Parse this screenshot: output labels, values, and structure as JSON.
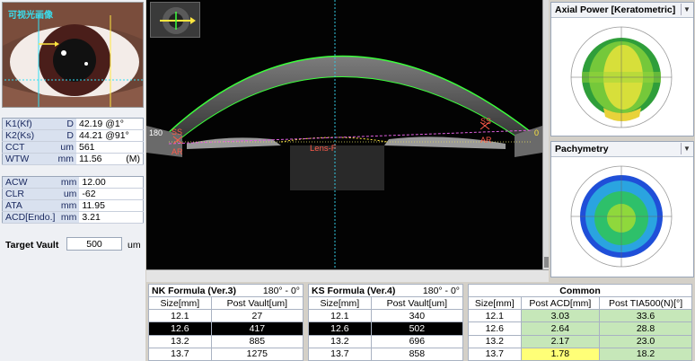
{
  "eye_photo": {
    "label": "可视光画像"
  },
  "measurements_a": [
    {
      "key": "K1(Kf)",
      "unit": "D",
      "value": "42.19 @1°"
    },
    {
      "key": "K2(Ks)",
      "unit": "D",
      "value": "44.21 @91°"
    },
    {
      "key": "CCT",
      "unit": "um",
      "value": "561"
    },
    {
      "key": "WTW",
      "unit": "mm",
      "value": "11.56",
      "flag": "(M)"
    }
  ],
  "measurements_b": [
    {
      "key": "ACW",
      "unit": "mm",
      "value": "12.00"
    },
    {
      "key": "CLR",
      "unit": "um",
      "value": "-62"
    },
    {
      "key": "ATA",
      "unit": "mm",
      "value": "11.95"
    },
    {
      "key": "ACD[Endo.]",
      "unit": "mm",
      "value": "3.21"
    }
  ],
  "target_vault": {
    "label": "Target Vault",
    "value": "500",
    "unit": "um"
  },
  "oct": {
    "left_tick": "180",
    "right_tick": "0",
    "ss_left": "SS",
    "ar_left": "AR",
    "ss_right": "SS",
    "ar_right": "AR",
    "lens_label": "Lens-F"
  },
  "maps": {
    "axial": {
      "title": "Axial Power [Keratometric]"
    },
    "pachy": {
      "title": "Pachymetry"
    }
  },
  "nk_formula": {
    "title": "NK Formula (Ver.3)",
    "angle": "180° - 0°",
    "headers": [
      "Size[mm]",
      "Post Vault[um]"
    ],
    "rows": [
      [
        "12.1",
        "27"
      ],
      [
        "12.6",
        "417"
      ],
      [
        "13.2",
        "885"
      ],
      [
        "13.7",
        "1275"
      ]
    ]
  },
  "ks_formula": {
    "title": "KS Formula (Ver.4)",
    "angle": "180° - 0°",
    "headers": [
      "Size[mm]",
      "Post Vault[um]"
    ],
    "rows": [
      [
        "12.1",
        "340"
      ],
      [
        "12.6",
        "502"
      ],
      [
        "13.2",
        "696"
      ],
      [
        "13.7",
        "858"
      ]
    ]
  },
  "common": {
    "title": "Common",
    "headers": [
      "Size[mm]",
      "Post ACD[mm]",
      "Post TIA500(N)[°]"
    ],
    "rows": [
      [
        "12.1",
        "3.03",
        "33.6"
      ],
      [
        "12.6",
        "2.64",
        "28.8"
      ],
      [
        "13.2",
        "2.17",
        "23.0"
      ],
      [
        "13.7",
        "1.78",
        "18.2"
      ]
    ]
  },
  "colors": {
    "selected_row": "#000000",
    "ok_cell": "#c6e7b9",
    "warn_cell": "#ffff77",
    "cornea_outline": "#3cff3c",
    "iris_marker": "#ff5a4a",
    "lens_line": "#e060e0"
  }
}
